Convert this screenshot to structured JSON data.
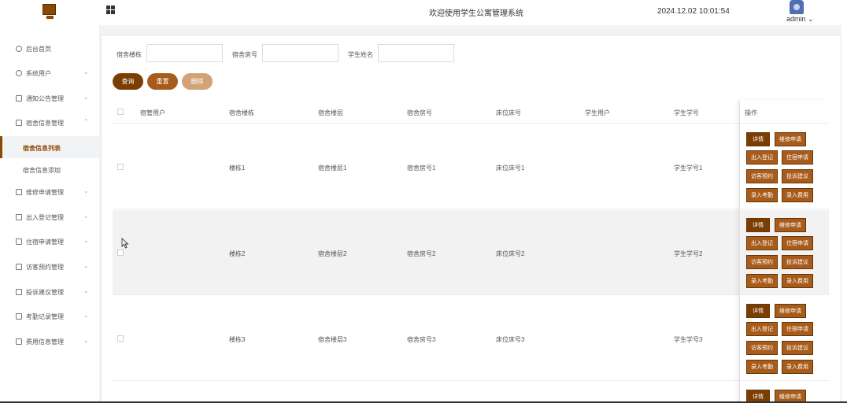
{
  "header": {
    "title": "欢迎使用学生公寓管理系统",
    "datetime": "2024.12.02 10:01:54",
    "user": "admin"
  },
  "sidebar": {
    "items": [
      {
        "label": "后台首页",
        "icon": "home-icon"
      },
      {
        "label": "系统用户",
        "icon": "user-icon"
      },
      {
        "label": "通知公告管理",
        "icon": "list-icon"
      },
      {
        "label": "宿舍信息管理",
        "icon": "list-icon"
      },
      {
        "label": "维修申请管理",
        "icon": "list-icon"
      },
      {
        "label": "出入登记管理",
        "icon": "list-icon"
      },
      {
        "label": "住宿申请管理",
        "icon": "list-icon"
      },
      {
        "label": "访客预约管理",
        "icon": "list-icon"
      },
      {
        "label": "投诉建议管理",
        "icon": "list-icon"
      },
      {
        "label": "考勤记录管理",
        "icon": "list-icon"
      },
      {
        "label": "费用信息管理",
        "icon": "list-icon"
      }
    ],
    "subitems": [
      {
        "label": "宿舍信息列表"
      },
      {
        "label": "宿舍信息添加"
      }
    ]
  },
  "search": {
    "building_label": "宿舍楼栋",
    "room_label": "宿舍房号",
    "student_label": "学生姓名",
    "building_value": "",
    "room_value": "",
    "student_value": ""
  },
  "actions": {
    "query": "查询",
    "reset": "重置",
    "delete": "删除"
  },
  "table": {
    "columns": [
      "宿管用户",
      "宿舍楼栋",
      "宿舍楼层",
      "宿舍房号",
      "床位床号",
      "学生用户",
      "学生学号",
      "操作"
    ],
    "rows": [
      {
        "manager": "",
        "building": "楼栋1",
        "floor": "宿舍楼层1",
        "room": "宿舍房号1",
        "bed": "床位床号1",
        "student_user": "",
        "student_no": "学生学号1"
      },
      {
        "manager": "",
        "building": "楼栋2",
        "floor": "宿舍楼层2",
        "room": "宿舍房号2",
        "bed": "床位床号2",
        "student_user": "",
        "student_no": "学生学号2"
      },
      {
        "manager": "",
        "building": "楼栋3",
        "floor": "宿舍楼层3",
        "room": "宿舍房号3",
        "bed": "床位床号3",
        "student_user": "",
        "student_no": "学生学号3"
      }
    ],
    "row_actions": [
      "详情",
      "维修申请",
      "出入登记",
      "住宿申请",
      "访客预约",
      "投诉建议",
      "录入考勤",
      "录入费用"
    ]
  },
  "colors": {
    "accent_dark": "#7a3e03",
    "accent": "#a85c1b",
    "accent_light": "#d2a376"
  }
}
